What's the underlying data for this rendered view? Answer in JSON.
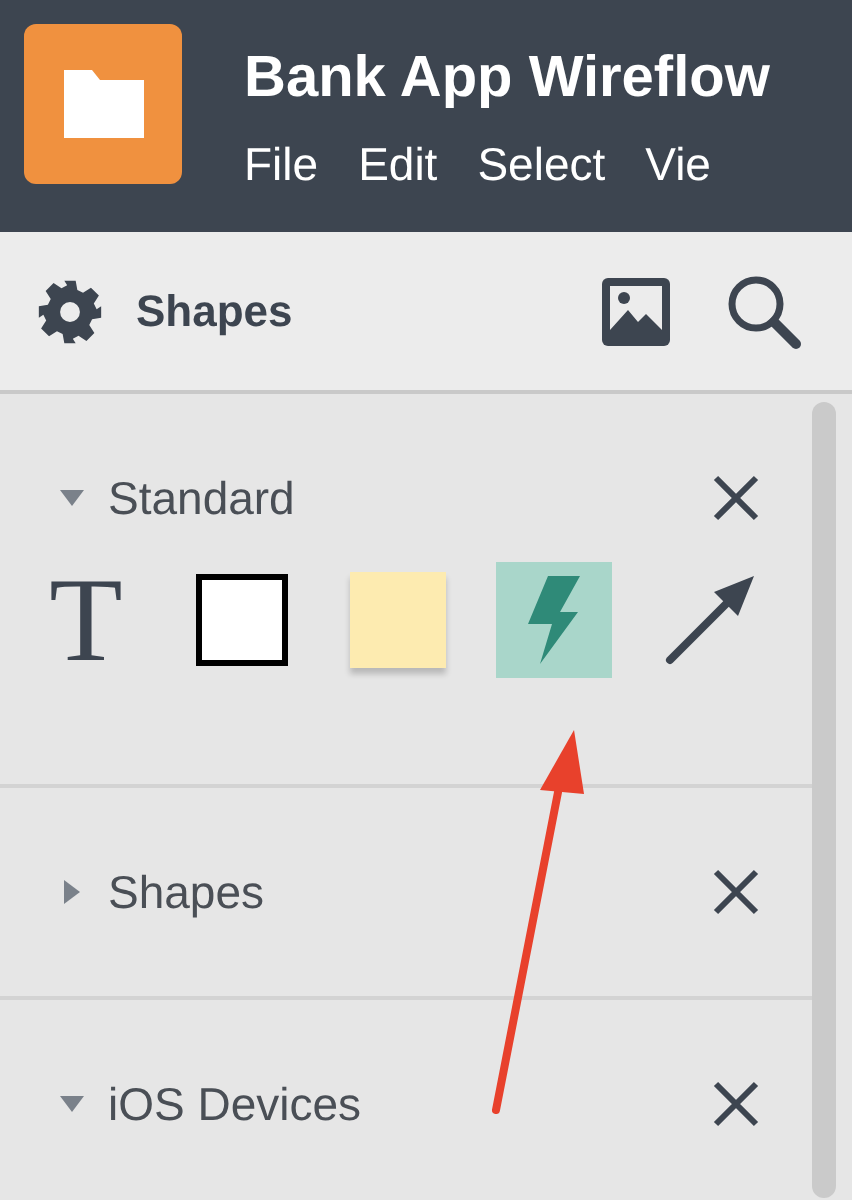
{
  "header": {
    "title": "Bank App Wireflow",
    "menu": [
      "File",
      "Edit",
      "Select",
      "Vie"
    ]
  },
  "toolbar": {
    "title": "Shapes"
  },
  "sections": [
    {
      "title": "Standard",
      "expanded": true,
      "tools": [
        {
          "kind": "text",
          "label": "T",
          "selected": false
        },
        {
          "kind": "rectangle",
          "selected": false
        },
        {
          "kind": "note",
          "selected": false
        },
        {
          "kind": "lightning",
          "selected": true
        },
        {
          "kind": "arrow",
          "selected": false
        }
      ]
    },
    {
      "title": "Shapes",
      "expanded": false
    },
    {
      "title": "iOS Devices",
      "expanded": true
    }
  ]
}
